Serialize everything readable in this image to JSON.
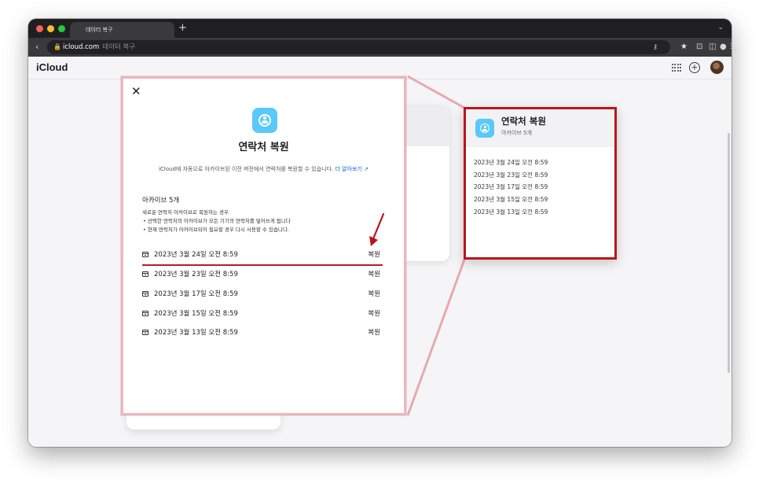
{
  "browser": {
    "tab_title": "데이터 복구",
    "new_tab": "+",
    "url_host": "icloud.com",
    "url_page": "데이터 복구"
  },
  "icloud": {
    "brand": "iCloud"
  },
  "dialog": {
    "title": "연락처 복원",
    "description": "iCloud에 자동으로 아카이브된 이전 버전에서 연락처를 복원할 수 있습니다.",
    "learn_more": "더 알아보기 ↗",
    "archive_count": "아카이브 5개",
    "note_heading": "새로운 연락처 아카이브로 복원하는 경우",
    "note_bullets": [
      "• 선택한 연락처의 아카이브가 모든 기기의 연락처를 덮어쓰게 됩니다",
      "• 현재 연락처가 아카이브되어 필요할 경우 다시 사용할 수 있습니다."
    ],
    "restore_label": "복원",
    "archives": [
      "2023년 3월 24일 오전 8:59",
      "2023년 3월 23일 오전 8:59",
      "2023년 3월 17일 오전 8:59",
      "2023년 3월 15일 오전 8:59",
      "2023년 3월 13일 오전 8:59"
    ]
  },
  "zoom": {
    "title": "연락처 복원",
    "subtitle": "아카이브 5개",
    "items": [
      "2023년 3월 24일 오전 8:59",
      "2023년 3월 23일 오전 8:59",
      "2023년 3월 17일 오전 8:59",
      "2023년 3월 15일 오전 8:59",
      "2023년 3월 13일 오전 8:59"
    ]
  },
  "colors": {
    "accent_link": "#0a66d6",
    "tile": "#5ac8fa",
    "annotation_red": "#b9151c"
  }
}
